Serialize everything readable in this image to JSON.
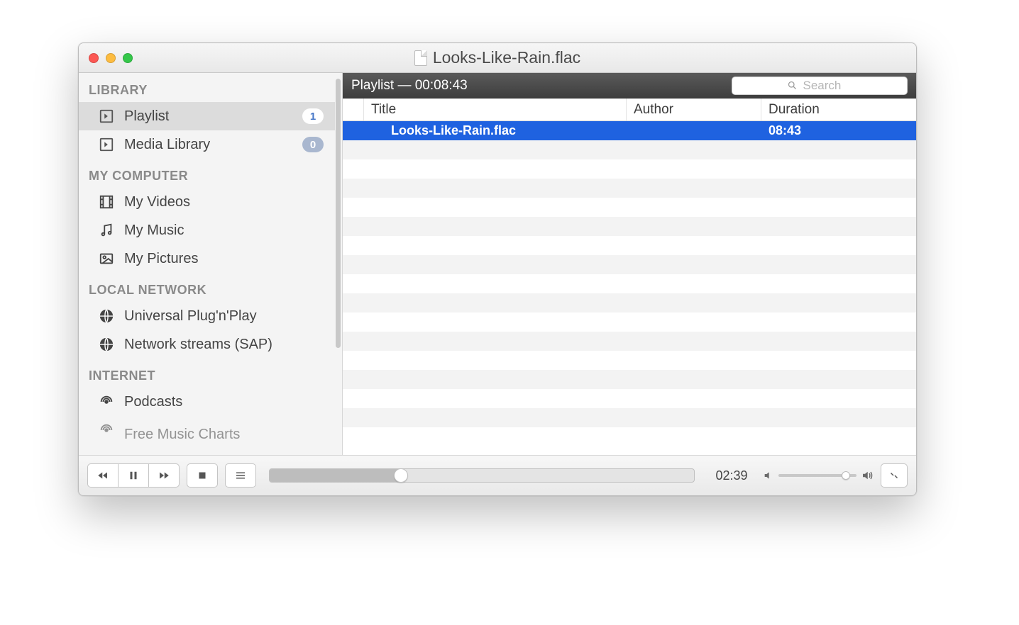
{
  "window": {
    "title": "Looks-Like-Rain.flac"
  },
  "sidebar": {
    "sections": [
      {
        "label": "LIBRARY",
        "items": [
          {
            "label": "Playlist",
            "badge": "1",
            "selected": true
          },
          {
            "label": "Media Library",
            "badge": "0"
          }
        ]
      },
      {
        "label": "MY COMPUTER",
        "items": [
          {
            "label": "My Videos"
          },
          {
            "label": "My Music"
          },
          {
            "label": "My Pictures"
          }
        ]
      },
      {
        "label": "LOCAL NETWORK",
        "items": [
          {
            "label": "Universal Plug'n'Play"
          },
          {
            "label": "Network streams (SAP)"
          }
        ]
      },
      {
        "label": "INTERNET",
        "items": [
          {
            "label": "Podcasts"
          },
          {
            "label": "Free Music Charts"
          }
        ]
      }
    ]
  },
  "main": {
    "header": "Playlist — 00:08:43",
    "search_placeholder": "Search",
    "columns": {
      "title": "Title",
      "author": "Author",
      "duration": "Duration"
    },
    "rows": [
      {
        "title": "Looks-Like-Rain.flac",
        "author": "",
        "duration": "08:43",
        "selected": true
      }
    ]
  },
  "controls": {
    "current_time": "02:39",
    "seek_percent": 31,
    "volume_percent": 86
  }
}
